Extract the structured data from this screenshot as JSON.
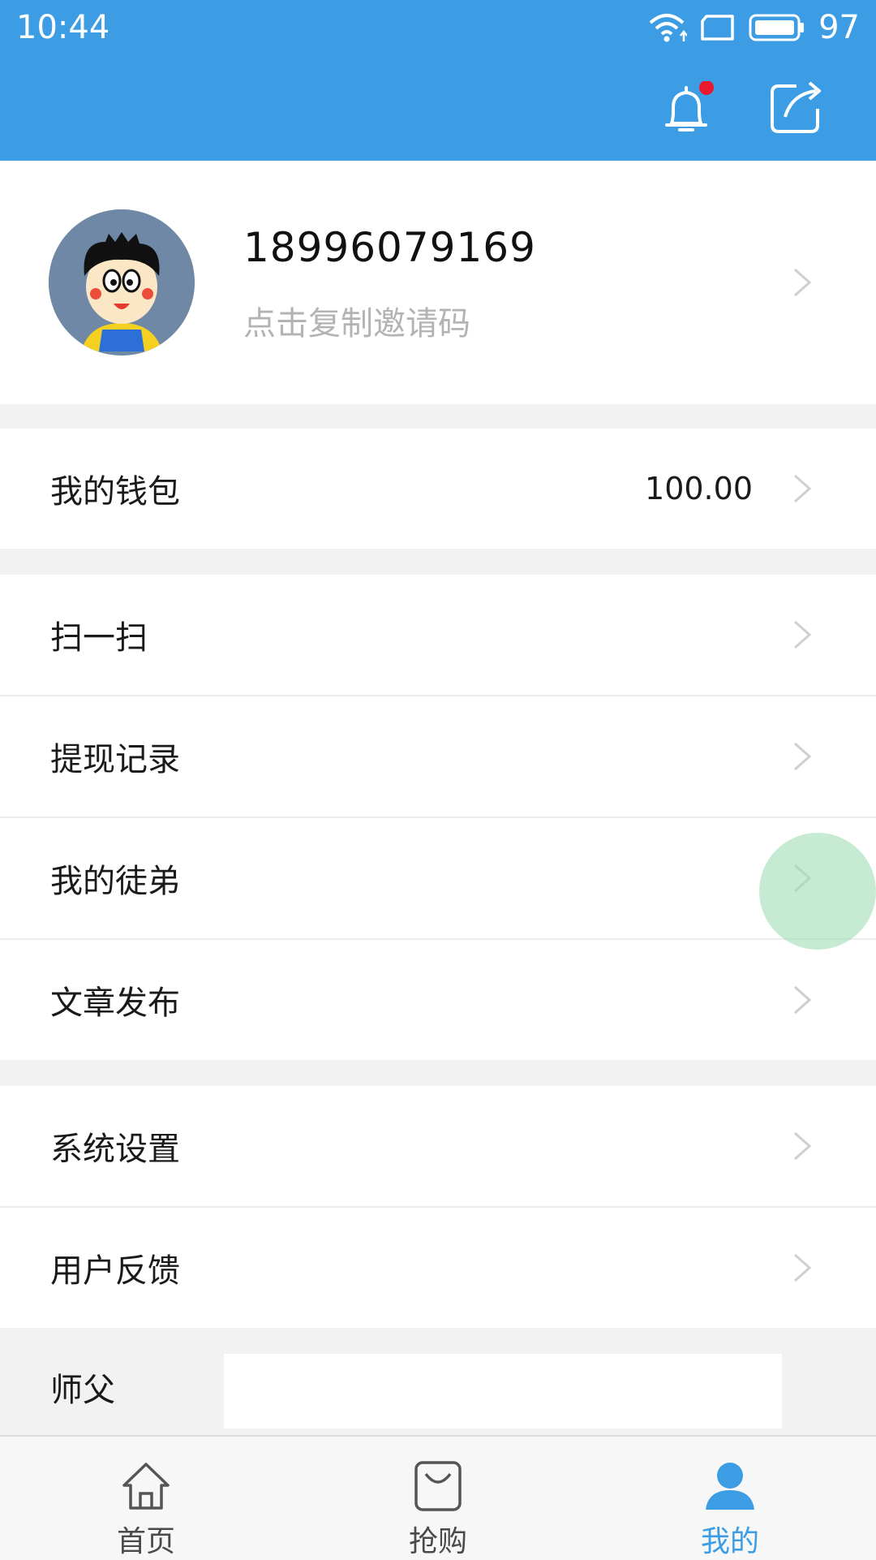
{
  "status_bar": {
    "time": "10:44",
    "battery": "97"
  },
  "header": {
    "bell_icon": "bell-icon",
    "share_icon": "share-icon",
    "colors": {
      "bar": "#3d9de4",
      "badge": "#e8192c"
    }
  },
  "profile": {
    "phone": "18996079169",
    "invite_hint": "点击复制邀请码"
  },
  "wallet": {
    "label": "我的钱包",
    "value": "100.00"
  },
  "menu_group_1": [
    {
      "label": "扫一扫"
    },
    {
      "label": "提现记录"
    },
    {
      "label": "我的徒弟"
    },
    {
      "label": "文章发布"
    }
  ],
  "menu_group_2": [
    {
      "label": "系统设置"
    },
    {
      "label": "用户反馈"
    }
  ],
  "master": {
    "label": "师父",
    "value": ""
  },
  "tabs": [
    {
      "label": "首页",
      "icon": "home-icon",
      "active": false
    },
    {
      "label": "抢购",
      "icon": "shopping-bag-icon",
      "active": false
    },
    {
      "label": "我的",
      "icon": "user-icon",
      "active": true
    }
  ],
  "colors": {
    "active_tab": "#3d9de4",
    "inactive_tab": "#4a4a4a"
  }
}
